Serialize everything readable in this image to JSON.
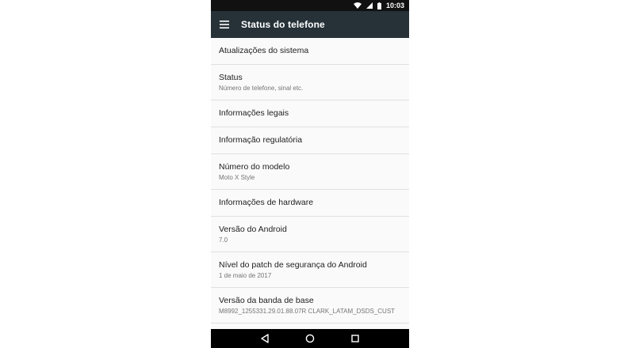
{
  "status_bar": {
    "time": "10:03",
    "icons": [
      "wifi-icon",
      "signal-icon",
      "battery-icon"
    ]
  },
  "appbar": {
    "title": "Status do telefone",
    "menu_icon": "hamburger-menu-icon"
  },
  "items": [
    {
      "title": "Atualizações do sistema",
      "subtitle": ""
    },
    {
      "title": "Status",
      "subtitle": "Número de telefone, sinal etc."
    },
    {
      "title": "Informações legais",
      "subtitle": ""
    },
    {
      "title": "Informação regulatória",
      "subtitle": ""
    },
    {
      "title": "Número do modelo",
      "subtitle": "Moto X Style"
    },
    {
      "title": "Informações de hardware",
      "subtitle": ""
    },
    {
      "title": "Versão do Android",
      "subtitle": "7.0"
    },
    {
      "title": "Nível do patch de segurança do Android",
      "subtitle": "1 de maio de 2017"
    },
    {
      "title": "Versão da banda de base",
      "subtitle": "M8992_1255331.29.01.88.07R CLARK_LATAM_DSDS_CUST"
    }
  ],
  "nav_bar": {
    "buttons": [
      "back-icon",
      "home-icon",
      "recents-icon"
    ]
  },
  "colors": {
    "appbar": "#263238",
    "status_bar": "#111111",
    "list_bg": "#fafafa",
    "divider": "#e0e0e0"
  }
}
